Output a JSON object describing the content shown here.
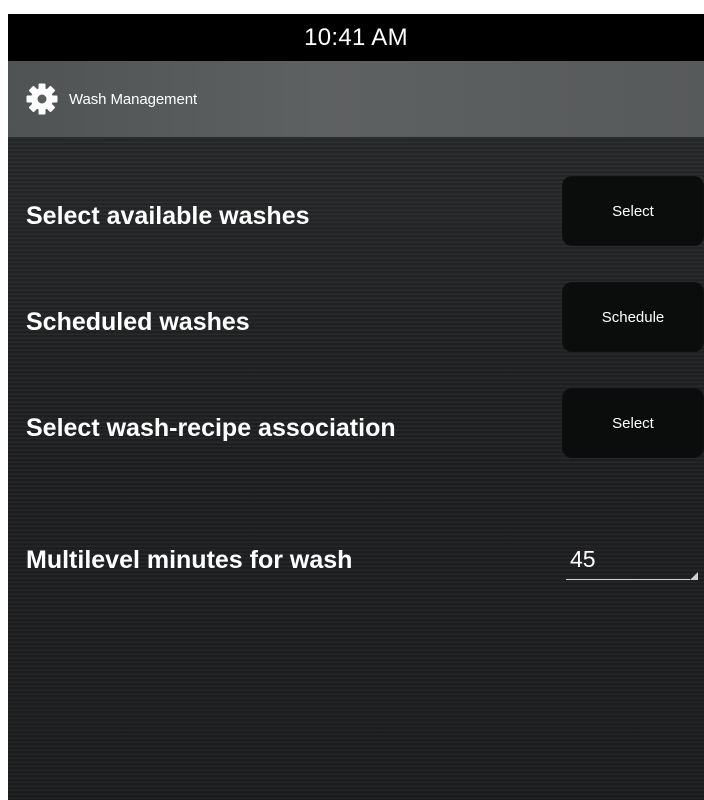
{
  "status_bar": {
    "time": "10:41 AM"
  },
  "title_bar": {
    "icon": "gear-icon",
    "title": "Wash Management"
  },
  "rows": [
    {
      "label": "Select available washes",
      "button_label": "Select"
    },
    {
      "label": "Scheduled washes",
      "button_label": "Schedule"
    },
    {
      "label": "Select wash-recipe association",
      "button_label": "Select"
    },
    {
      "label": "Multilevel minutes for wash",
      "value": "45"
    }
  ],
  "colors": {
    "status_bar": "#000000",
    "title_bar": "#5a5d5e",
    "background": "#1f2021",
    "button": "#0b0c0c",
    "text": "#ffffff"
  }
}
